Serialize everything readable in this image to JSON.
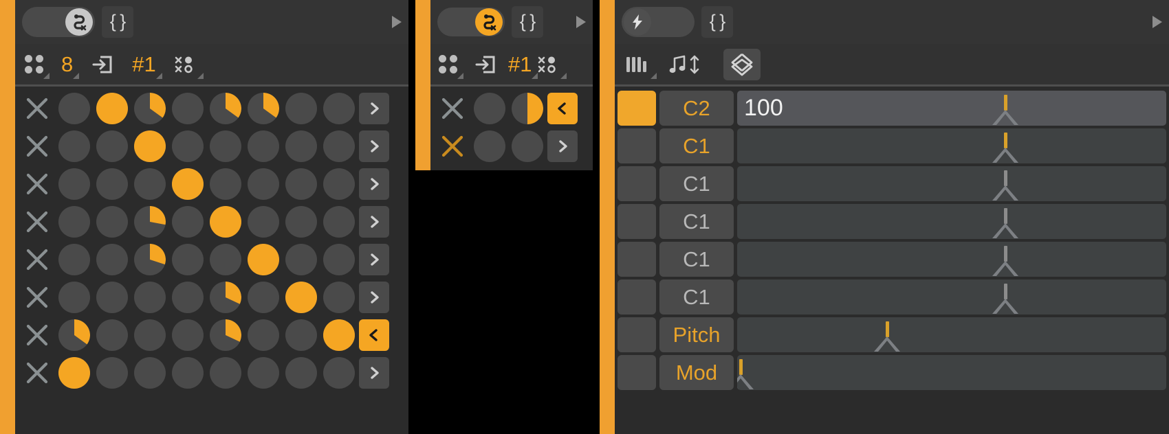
{
  "accent_color": "#f0a030",
  "orange": "#f5a623",
  "panels": [
    {
      "id": "euclid-1",
      "titlebar": {
        "toggle_icon": "snake-toggle-icon",
        "toggle_active": false,
        "braces_label": "{ }",
        "play_icon": "play-triangle-icon"
      },
      "toolbar": {
        "items": [
          {
            "icon": "four-dots-icon",
            "label": "",
            "name": "channels-icon"
          },
          {
            "icon": "",
            "label": "8",
            "name": "steps-value"
          },
          {
            "icon": "enter-box-icon",
            "label": "",
            "name": "input-icon"
          },
          {
            "icon": "",
            "label": "#1",
            "name": "pattern-number"
          },
          {
            "icon": "scatter-icon",
            "label": "",
            "name": "randomize-icon"
          }
        ]
      },
      "rows": [
        {
          "x": "clear-x",
          "x_active": false,
          "steps": [
            0,
            1,
            0.35,
            0,
            0.35,
            0.35,
            0,
            0
          ],
          "arrow": "right",
          "arrow_sel": false
        },
        {
          "x": "clear-x",
          "x_active": false,
          "steps": [
            0,
            0,
            1,
            0,
            0,
            0,
            0,
            0
          ],
          "arrow": "right",
          "arrow_sel": false
        },
        {
          "x": "clear-x",
          "x_active": false,
          "steps": [
            0,
            0,
            0,
            1,
            0,
            0,
            0,
            0
          ],
          "arrow": "right",
          "arrow_sel": false
        },
        {
          "x": "clear-x",
          "x_active": false,
          "steps": [
            0,
            0,
            0.28,
            0,
            1,
            0,
            0,
            0
          ],
          "arrow": "right",
          "arrow_sel": false
        },
        {
          "x": "clear-x",
          "x_active": false,
          "steps": [
            0,
            0,
            0.3,
            0,
            0,
            1,
            0,
            0
          ],
          "arrow": "right",
          "arrow_sel": false
        },
        {
          "x": "clear-x",
          "x_active": false,
          "steps": [
            0,
            0,
            0,
            0,
            0.32,
            0,
            1,
            0
          ],
          "arrow": "right",
          "arrow_sel": false
        },
        {
          "x": "clear-x",
          "x_active": false,
          "steps": [
            0.35,
            0,
            0,
            0,
            0.32,
            0,
            0,
            1
          ],
          "arrow": "left",
          "arrow_sel": true
        },
        {
          "x": "clear-x",
          "x_active": false,
          "steps": [
            1,
            0,
            0,
            0,
            0,
            0,
            0,
            0
          ],
          "arrow": "right",
          "arrow_sel": false
        }
      ]
    },
    {
      "id": "euclid-2",
      "titlebar": {
        "toggle_icon": "snake-toggle-icon",
        "toggle_active": true,
        "braces_label": "{ }",
        "play_icon": "play-triangle-icon"
      },
      "toolbar": {
        "items": [
          {
            "icon": "four-dots-icon",
            "label": "",
            "name": "channels-icon"
          },
          {
            "icon": "enter-box-icon",
            "label": "",
            "name": "input-icon"
          },
          {
            "icon": "",
            "label": "#1",
            "name": "pattern-number"
          },
          {
            "icon": "scatter-icon",
            "label": "",
            "name": "randomize-icon"
          }
        ]
      },
      "rows": [
        {
          "x": "clear-x",
          "x_active": false,
          "steps": [
            0,
            0.5
          ],
          "arrow": "left",
          "arrow_sel": true
        },
        {
          "x": "clear-x",
          "x_active": true,
          "steps": [
            0,
            0
          ],
          "arrow": "right",
          "arrow_sel": false
        }
      ]
    }
  ],
  "note_panel": {
    "titlebar": {
      "toggle_icon": "lightning-toggle-icon",
      "toggle_active": false,
      "braces_label": "{ }",
      "play_icon": "play-triangle-icon"
    },
    "toolbar": {
      "items": [
        {
          "icon": "keyboard-keys-icon",
          "name": "keyboard-icon"
        },
        {
          "icon": "note-updown-icon",
          "name": "transpose-icon"
        },
        {
          "icon": "diamond-updown-icon",
          "name": "range-icon",
          "boxed": true
        }
      ]
    },
    "rows": [
      {
        "enabled": true,
        "label": "C2",
        "label_hl": true,
        "value": "100",
        "lit": true,
        "marker_pos": 62.5,
        "marker_on": true
      },
      {
        "enabled": false,
        "label": "C1",
        "label_hl": true,
        "value": "",
        "lit": false,
        "marker_pos": 62.5,
        "marker_on": true
      },
      {
        "enabled": false,
        "label": "C1",
        "label_hl": false,
        "value": "",
        "lit": false,
        "marker_pos": 62.5,
        "marker_on": false
      },
      {
        "enabled": false,
        "label": "C1",
        "label_hl": false,
        "value": "",
        "lit": false,
        "marker_pos": 62.5,
        "marker_on": false
      },
      {
        "enabled": false,
        "label": "C1",
        "label_hl": false,
        "value": "",
        "lit": false,
        "marker_pos": 62.5,
        "marker_on": false
      },
      {
        "enabled": false,
        "label": "C1",
        "label_hl": false,
        "value": "",
        "lit": false,
        "marker_pos": 62.5,
        "marker_on": false
      },
      {
        "enabled": false,
        "label": "Pitch",
        "label_hl": true,
        "value": "",
        "lit": false,
        "marker_pos": 35.0,
        "marker_on": true
      },
      {
        "enabled": false,
        "label": "Mod",
        "label_hl": true,
        "value": "",
        "lit": false,
        "marker_pos": 0.8,
        "marker_on": true
      }
    ]
  }
}
